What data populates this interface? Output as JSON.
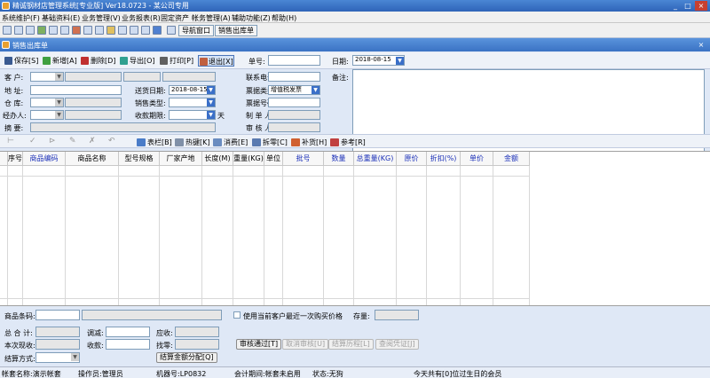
{
  "app": {
    "title": "精诚钢材店管理系统[专业版] Ver18.0723 - 某公司专用"
  },
  "menu": [
    "系统维护(F)",
    "基础资料(E)",
    "业务管理(V)",
    "业务报表(R)",
    "固定资产",
    "帐务管理(A)",
    "辅助功能(Z)",
    "帮助(H)"
  ],
  "toolbar": {
    "nav_window": "导航窗口",
    "sales_out": "销售出库单"
  },
  "child_window": {
    "title": "销售出库单"
  },
  "actions": {
    "save": "保存[S]",
    "add": "新增[A]",
    "delete": "删除[D]",
    "export": "导出[O]",
    "print": "打印[P]",
    "exit": "退出[X]"
  },
  "header": {
    "doc_no_label": "单号:",
    "doc_no": "",
    "date_label": "日期:",
    "date": "2018-08-15",
    "notes_label": "备注:"
  },
  "form": {
    "customer_label": "客  户:",
    "address_label": "地  址:",
    "warehouse_label": "仓  库:",
    "handler_label": "经办人:",
    "summary_label": "摘  要:",
    "delivery_date_label": "送货日期:",
    "delivery_date": "2018-08-15",
    "sales_type_label": "销售类型:",
    "collect_label": "收款期限:",
    "collect_unit": "天",
    "contact_label": "联系电话:",
    "invoice_type_label": "票据类型:",
    "invoice_type": "增值税发票",
    "invoice_no_label": "票据号码:",
    "maker_label": "制 单 人:",
    "reviewer_label": "审 核 人:"
  },
  "grid_toolbar": {
    "table": "表栏[B]",
    "hotkey": "热键[K]",
    "spend": "消费[E]",
    "split": "拆零[C]",
    "supplement": "补货[H]",
    "reference": "参考[R]"
  },
  "columns": [
    "序号",
    "商品编码",
    "商品名称",
    "型号规格",
    "厂家产地",
    "长度(M)",
    "重量(KG)",
    "单位",
    "批号",
    "数量",
    "总重量(KG)",
    "原价",
    "折扣(%)",
    "单价",
    "金额"
  ],
  "bottom": {
    "barcode_label": "商品条码:",
    "use_last_price": "使用当前客户最近一次购买价格",
    "stock_label": "存量:",
    "total_label": "总 合 计:",
    "adjust_label": "调减:",
    "receivable_label": "应收:",
    "received_label": "本次现收:",
    "collect_label": "收款:",
    "change_label": "找零:",
    "settle_label": "结算方式:",
    "settle_split": "结算金额分配[Q]",
    "approve": "审核通过[T]",
    "cancel_approve": "取消审核[U]",
    "settle_history": "结算历程[L]",
    "voucher": "查阅凭证[J]"
  },
  "status": {
    "account": "帐套名称:演示帐套",
    "operator": "操作员:管理员",
    "machine": "机器号:LP0832",
    "period": "会计期间:帐套未启用",
    "state": "状态:无狗",
    "birthday": "今天共有[0]位过生日的会员"
  }
}
